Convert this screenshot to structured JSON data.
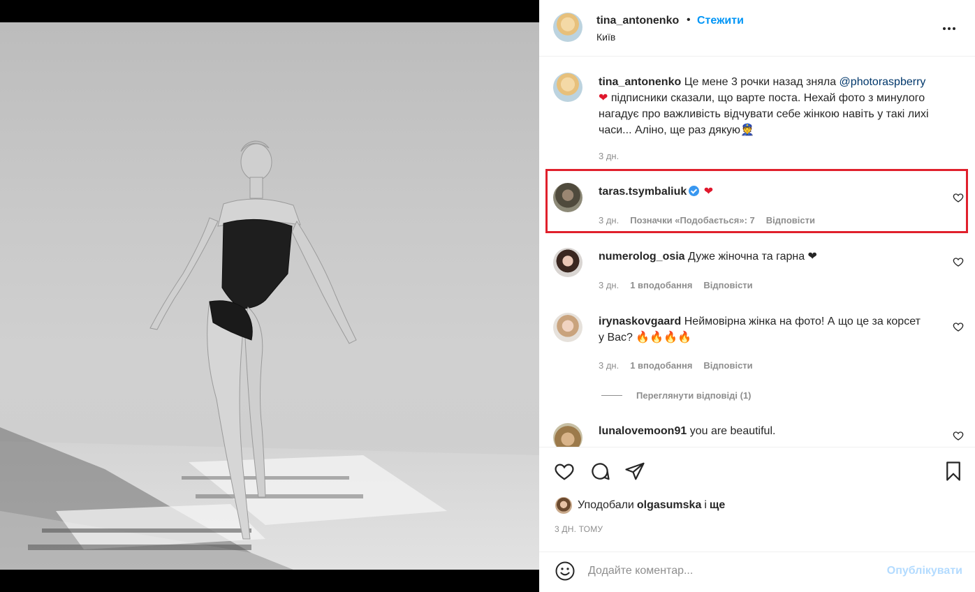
{
  "post": {
    "author": "tina_antonenko",
    "separator": "•",
    "follow_label": "Стежити",
    "location": "Київ",
    "more_icon": "more-horizontal-icon"
  },
  "caption": {
    "author": "tina_antonenko",
    "text_1": "Це мене 3 рочки назад зняла",
    "mention": "@photoraspberry",
    "heart": "❤",
    "text_2": "підписники сказали, що варте поста. Нехай фото з минулого нагадує про важливість відчувати себе жінкою навіть у такі лихі часи... Аліно, ще раз дякую",
    "emoji": "👮",
    "time": "3 дн."
  },
  "comments": [
    {
      "user": "taras.tsymbaliuk",
      "verified": true,
      "text": "❤",
      "time": "3 дн.",
      "likes": "Позначки «Подобається»: 7",
      "reply": "Відповісти",
      "highlighted": true
    },
    {
      "user": "numerolog_osia",
      "text": "Дуже жіночна та гарна ❤",
      "time": "3 дн.",
      "likes": "1 вподобання",
      "reply": "Відповісти"
    },
    {
      "user": "irynaskovgaard",
      "text": "Неймовірна жінка на фото! А що це за корсет у Вас? 🔥🔥🔥🔥",
      "time": "3 дн.",
      "likes": "1 вподобання",
      "reply": "Відповісти"
    },
    {
      "user": "lunalovemoon91",
      "text": "you are beautiful."
    }
  ],
  "view_replies": "Переглянути відповіді (1)",
  "actions": {
    "like_icon": "heart-icon",
    "comment_icon": "comment-icon",
    "share_icon": "share-icon",
    "save_icon": "bookmark-icon"
  },
  "likes": {
    "prefix": "Уподобали",
    "user": "olgasumska",
    "middle": "і",
    "suffix": "ще"
  },
  "time_ago": "3 ДН. ТОМУ",
  "comment_box": {
    "placeholder": "Додайте коментар...",
    "publish_label": "Опублікувати",
    "emoji_icon": "smiley-icon"
  },
  "colors": {
    "accent": "#0095f6",
    "highlight_border": "#e0202c",
    "heart": "#e0182d",
    "verified": "#3897f0",
    "publish_disabled": "#b3dbff"
  }
}
